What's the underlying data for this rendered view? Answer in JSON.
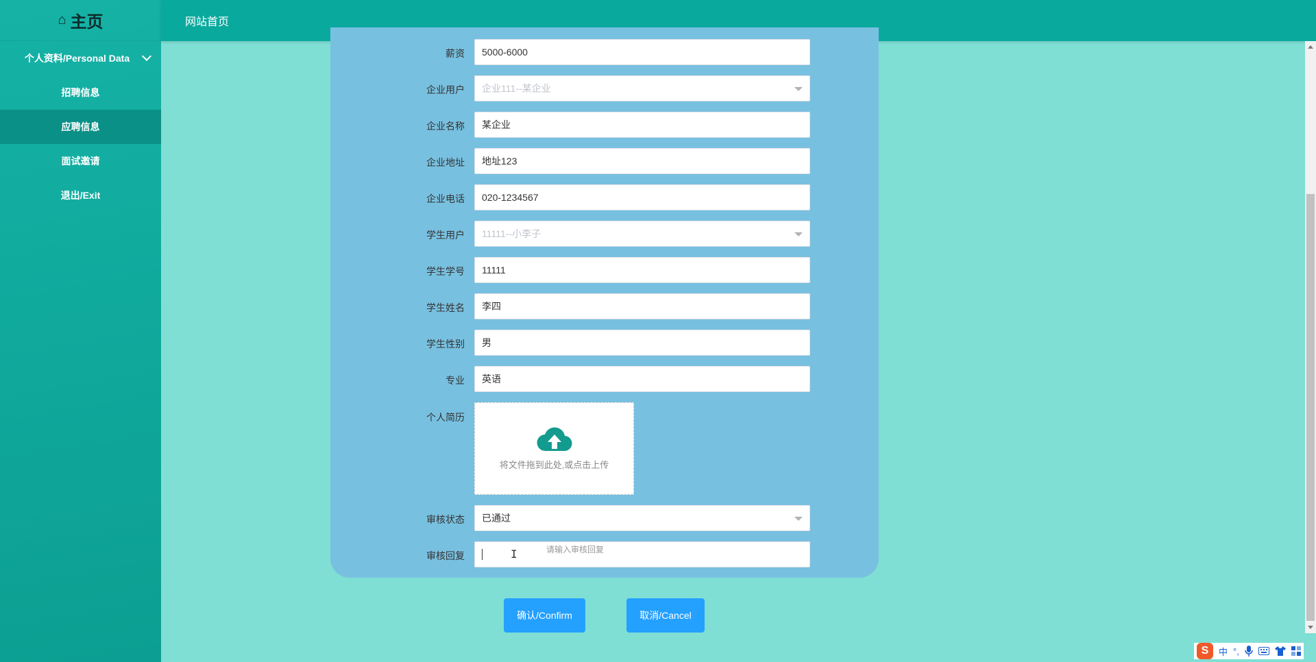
{
  "sidebar": {
    "title": "主页",
    "home_icon": "⌂",
    "group_label": "个人资料/Personal Data",
    "items": [
      {
        "label": "招聘信息"
      },
      {
        "label": "应聘信息"
      },
      {
        "label": "面试邀请"
      },
      {
        "label": "退出/Exit"
      }
    ]
  },
  "topbar": {
    "home_link": "网站首页"
  },
  "form": {
    "salary": {
      "label": "薪资",
      "value": "5000-6000"
    },
    "company_user": {
      "label": "企业用户",
      "value": "企业111--某企业"
    },
    "company_name": {
      "label": "企业名称",
      "value": "某企业"
    },
    "company_address": {
      "label": "企业地址",
      "value": "地址123"
    },
    "company_phone": {
      "label": "企业电话",
      "value": "020-1234567"
    },
    "student_user": {
      "label": "学生用户",
      "value": "11111--小李子"
    },
    "student_id": {
      "label": "学生学号",
      "value": "11111"
    },
    "student_name": {
      "label": "学生姓名",
      "value": "李四"
    },
    "student_gender": {
      "label": "学生性别",
      "value": "男"
    },
    "major": {
      "label": "专业",
      "value": "英语"
    },
    "resume": {
      "label": "个人简历",
      "upload_text": "将文件拖到此处,或点击上传"
    },
    "review_status": {
      "label": "审核状态",
      "value": "已通过"
    },
    "review_reply": {
      "label": "审核回复",
      "placeholder": "请输入审核回复"
    }
  },
  "buttons": {
    "confirm": "确认/Confirm",
    "cancel": "取消/Cancel"
  },
  "ime": {
    "lang": "中",
    "punct": "°,",
    "logo": "S"
  },
  "colors": {
    "accent": "#0aa99e",
    "button": "#24a0ff",
    "panel": "#78c0e0",
    "background": "#7fdfd4"
  }
}
